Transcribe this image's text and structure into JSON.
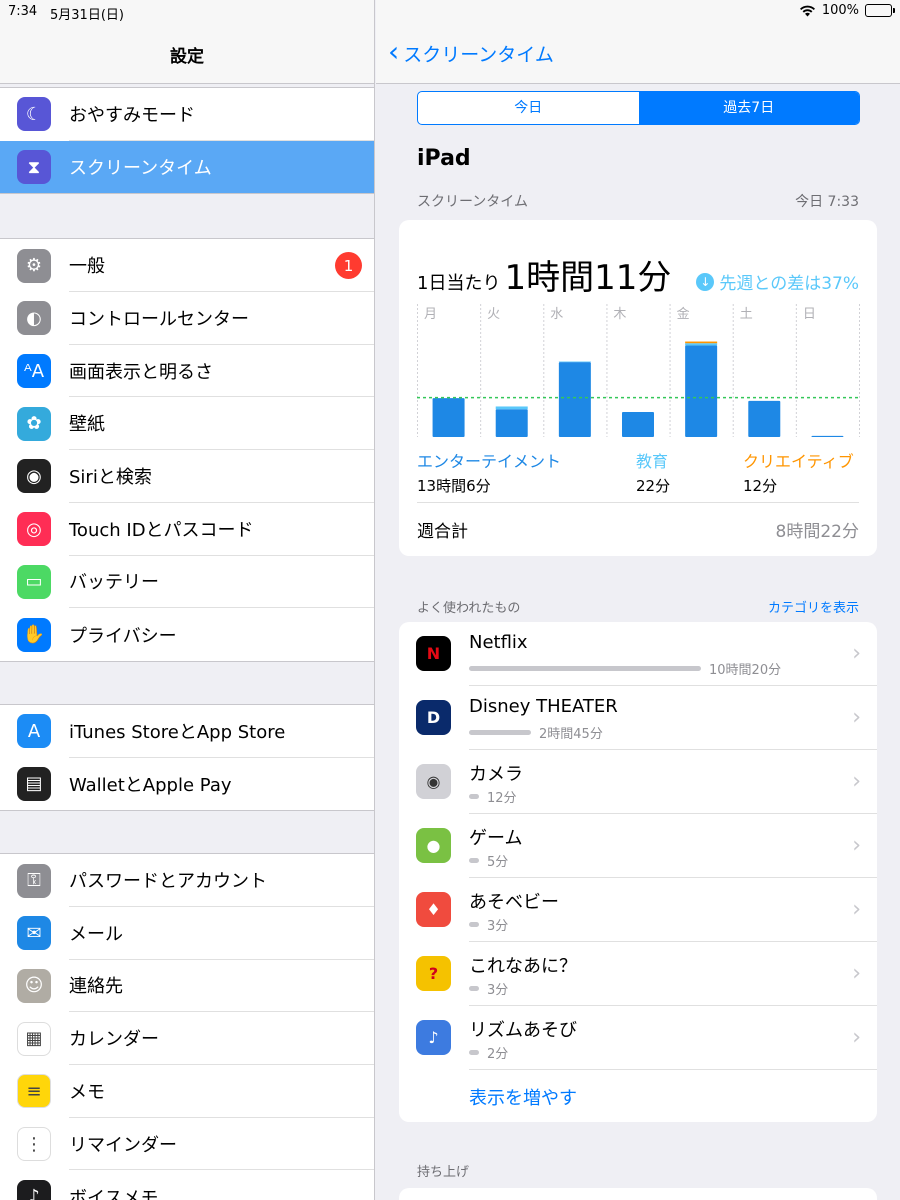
{
  "status": {
    "time": "7:34",
    "date": "5月31日(日)",
    "battery": "100%"
  },
  "sidebar": {
    "title": "設定",
    "groups": [
      [
        {
          "label": "おやすみモード",
          "icon": "moon-icon",
          "color": "#5856d6"
        },
        {
          "label": "スクリーンタイム",
          "icon": "hourglass-icon",
          "color": "#5856d6",
          "selected": true
        }
      ],
      [
        {
          "label": "一般",
          "icon": "gear-icon",
          "color": "#8e8e93",
          "badge": "1"
        },
        {
          "label": "コントロールセンター",
          "icon": "toggles-icon",
          "color": "#8e8e93"
        },
        {
          "label": "画面表示と明るさ",
          "icon": "text-size-icon",
          "color": "#007aff"
        },
        {
          "label": "壁紙",
          "icon": "flower-icon",
          "color": "#34aadc"
        },
        {
          "label": "Siriと検索",
          "icon": "siri-icon",
          "color": "#222222"
        },
        {
          "label": "Touch IDとパスコード",
          "icon": "fingerprint-icon",
          "color": "#ff2d55"
        },
        {
          "label": "バッテリー",
          "icon": "battery-icon",
          "color": "#4cd964"
        },
        {
          "label": "プライバシー",
          "icon": "hand-icon",
          "color": "#007aff"
        }
      ],
      [
        {
          "label": "iTunes StoreとApp Store",
          "icon": "app-store-icon",
          "color": "#1c8cf5"
        },
        {
          "label": "WalletとApple Pay",
          "icon": "wallet-icon",
          "color": "#222222"
        }
      ],
      [
        {
          "label": "パスワードとアカウント",
          "icon": "key-icon",
          "color": "#8e8e93"
        },
        {
          "label": "メール",
          "icon": "mail-icon",
          "color": "#1e88e5"
        },
        {
          "label": "連絡先",
          "icon": "contacts-icon",
          "color": "#b0aca4"
        },
        {
          "label": "カレンダー",
          "icon": "calendar-icon",
          "color": "#ffffff"
        },
        {
          "label": "メモ",
          "icon": "notes-icon",
          "color": "#ffd60a"
        },
        {
          "label": "リマインダー",
          "icon": "reminders-icon",
          "color": "#ffffff"
        },
        {
          "label": "ボイスメモ",
          "icon": "voice-memo-icon",
          "color": "#1c1c1e"
        }
      ]
    ]
  },
  "main": {
    "back_label": "スクリーンタイム",
    "segments": [
      {
        "label": "今日",
        "active": false
      },
      {
        "label": "過去7日",
        "active": true
      }
    ],
    "device": "iPad",
    "section_label": "スクリーンタイム",
    "section_time": "今日 7:33",
    "daily_prefix": "1日当たり",
    "daily_value": "1時間11分",
    "diff_text": "先週との差は37%",
    "weekly_label": "週合計",
    "weekly_value": "8時間22分",
    "categories": [
      {
        "name": "エンターテイメント",
        "value": "13時間6分",
        "color": "#1e88e5"
      },
      {
        "name": "教育",
        "value": "22分",
        "color": "#5ac8fa"
      },
      {
        "name": "クリエイティブ",
        "value": "12分",
        "color": "#ff9500"
      }
    ],
    "most_used_label": "よく使われたもの",
    "show_categories": "カテゴリを表示",
    "apps": [
      {
        "name": "Netflix",
        "time": "10時間20分",
        "minutes": 620,
        "icon": "netflix-icon",
        "bg": "#000000",
        "fg": "#e50914",
        "glyph": "N"
      },
      {
        "name": "Disney THEATER",
        "time": "2時間45分",
        "minutes": 165,
        "icon": "disney-theater-icon",
        "bg": "#0a2a6b",
        "fg": "#ffffff",
        "glyph": "D"
      },
      {
        "name": "カメラ",
        "time": "12分",
        "minutes": 12,
        "icon": "camera-icon",
        "bg": "#d1d1d6",
        "fg": "#333333",
        "glyph": "◉"
      },
      {
        "name": "ゲーム",
        "time": "5分",
        "minutes": 5,
        "icon": "game-app-icon",
        "bg": "#7ac143",
        "fg": "#ffffff",
        "glyph": "●"
      },
      {
        "name": "あそベビー",
        "time": "3分",
        "minutes": 3,
        "icon": "asobaby-icon",
        "bg": "#f04b3e",
        "fg": "#ffffff",
        "glyph": "♦"
      },
      {
        "name": "これなあに？",
        "time": "3分",
        "minutes": 3,
        "icon": "korenani-icon",
        "bg": "#f5c200",
        "fg": "#d0021b",
        "glyph": "?"
      },
      {
        "name": "リズムあそび",
        "time": "2分",
        "minutes": 2,
        "icon": "rhythm-icon",
        "bg": "#3d7be0",
        "fg": "#ffffff",
        "glyph": "♪"
      }
    ],
    "show_more": "表示を増やす",
    "pickups_label": "持ち上げ"
  },
  "chart_data": {
    "type": "bar",
    "categories": [
      "月",
      "火",
      "水",
      "木",
      "金",
      "土",
      "日"
    ],
    "series": [
      {
        "name": "エンターテイメント",
        "values": [
          70,
          50,
          135,
          45,
          165,
          65,
          2
        ]
      },
      {
        "name": "教育",
        "values": [
          0,
          5,
          1,
          0,
          4,
          0,
          0
        ]
      },
      {
        "name": "クリエイティブ",
        "values": [
          0,
          0,
          0,
          0,
          3,
          0,
          0
        ]
      }
    ],
    "average": 71,
    "ymax": 200,
    "average_line_color": "#34c759"
  }
}
